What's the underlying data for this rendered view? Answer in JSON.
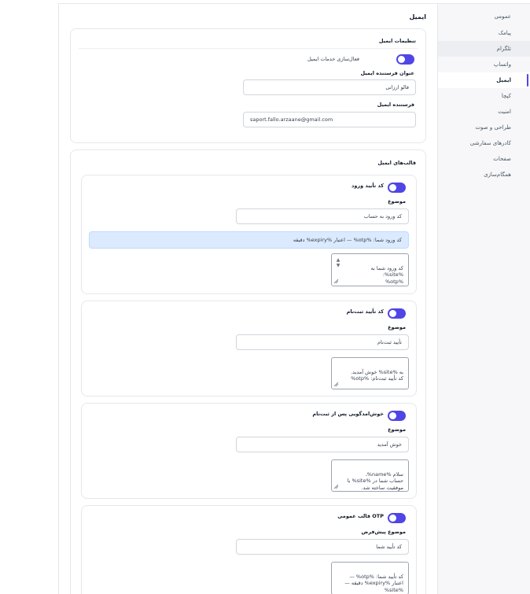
{
  "sidebar": {
    "items": [
      {
        "label": "عمومی"
      },
      {
        "label": "پیامک"
      },
      {
        "label": "تلگرام"
      },
      {
        "label": "واتساپ"
      },
      {
        "label": "ایمیل"
      },
      {
        "label": "کپچا"
      },
      {
        "label": "امنیت"
      },
      {
        "label": "طراحی و صوت"
      },
      {
        "label": "کادرهای سفارشی"
      },
      {
        "label": "صفحات"
      },
      {
        "label": "همگام‌سازی"
      }
    ],
    "active_index": 4
  },
  "page": {
    "title": "ایمیل"
  },
  "settings": {
    "title": "تنظیمات ایمیل",
    "enable_label": "فعال‌سازی خدمات ایمیل",
    "enable_on": true,
    "sender_title_label": "عنوان فرستنده ایمیل",
    "sender_title_value": "فالو ارزانی",
    "sender_label": "فرستنده ایمیل",
    "sender_value": "saport.fallo.arzaane@gmail.com"
  },
  "templates": {
    "title": "قالب‌های ایمیل",
    "subject_label": "موضوع",
    "items": [
      {
        "name": "کد تأیید ورود",
        "enabled": true,
        "subject": "کد ورود به حساب",
        "info": "کد ورود شما: %otp% — اعتبار %expiry% دقیقه",
        "body": "کد ورود شما به\n%site%:\n%otp%"
      },
      {
        "name": "کد تأیید ثبت‌نام",
        "enabled": true,
        "subject": "تأیید ثبت‌نام",
        "body": "به %site% خوش آمدید.\nکد تأیید ثبت‌نام: %otp%"
      },
      {
        "name": "خوش‌امدگویی پس از ثبت‌نام",
        "enabled": true,
        "subject": "خوش آمدید",
        "body": "سلام %name%،\nحساب شما در %site% با\nموفقیت ساخته شد."
      },
      {
        "name": "قالب عمومی OTP",
        "enabled": true,
        "subject_label": "موضوع پیش‌فرض",
        "subject": "کد تأیید شما",
        "body": "کد تأیید شما: %otp% —\nاعتبار %expiry% دقیقه —\n%site%"
      }
    ]
  },
  "colors": {
    "accent": "#4f46e5",
    "info_bg": "#dbeafe"
  }
}
